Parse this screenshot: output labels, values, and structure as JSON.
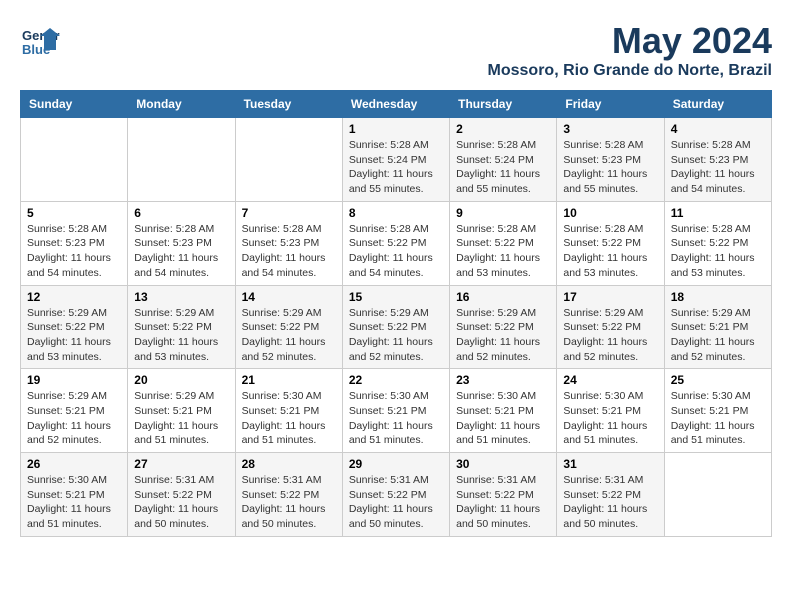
{
  "logo": {
    "line1": "General",
    "line2": "Blue"
  },
  "title": "May 2024",
  "location": "Mossoro, Rio Grande do Norte, Brazil",
  "days_header": [
    "Sunday",
    "Monday",
    "Tuesday",
    "Wednesday",
    "Thursday",
    "Friday",
    "Saturday"
  ],
  "weeks": [
    [
      {
        "day": "",
        "info": ""
      },
      {
        "day": "",
        "info": ""
      },
      {
        "day": "",
        "info": ""
      },
      {
        "day": "1",
        "info": "Sunrise: 5:28 AM\nSunset: 5:24 PM\nDaylight: 11 hours\nand 55 minutes."
      },
      {
        "day": "2",
        "info": "Sunrise: 5:28 AM\nSunset: 5:24 PM\nDaylight: 11 hours\nand 55 minutes."
      },
      {
        "day": "3",
        "info": "Sunrise: 5:28 AM\nSunset: 5:23 PM\nDaylight: 11 hours\nand 55 minutes."
      },
      {
        "day": "4",
        "info": "Sunrise: 5:28 AM\nSunset: 5:23 PM\nDaylight: 11 hours\nand 54 minutes."
      }
    ],
    [
      {
        "day": "5",
        "info": "Sunrise: 5:28 AM\nSunset: 5:23 PM\nDaylight: 11 hours\nand 54 minutes."
      },
      {
        "day": "6",
        "info": "Sunrise: 5:28 AM\nSunset: 5:23 PM\nDaylight: 11 hours\nand 54 minutes."
      },
      {
        "day": "7",
        "info": "Sunrise: 5:28 AM\nSunset: 5:23 PM\nDaylight: 11 hours\nand 54 minutes."
      },
      {
        "day": "8",
        "info": "Sunrise: 5:28 AM\nSunset: 5:22 PM\nDaylight: 11 hours\nand 54 minutes."
      },
      {
        "day": "9",
        "info": "Sunrise: 5:28 AM\nSunset: 5:22 PM\nDaylight: 11 hours\nand 53 minutes."
      },
      {
        "day": "10",
        "info": "Sunrise: 5:28 AM\nSunset: 5:22 PM\nDaylight: 11 hours\nand 53 minutes."
      },
      {
        "day": "11",
        "info": "Sunrise: 5:28 AM\nSunset: 5:22 PM\nDaylight: 11 hours\nand 53 minutes."
      }
    ],
    [
      {
        "day": "12",
        "info": "Sunrise: 5:29 AM\nSunset: 5:22 PM\nDaylight: 11 hours\nand 53 minutes."
      },
      {
        "day": "13",
        "info": "Sunrise: 5:29 AM\nSunset: 5:22 PM\nDaylight: 11 hours\nand 53 minutes."
      },
      {
        "day": "14",
        "info": "Sunrise: 5:29 AM\nSunset: 5:22 PM\nDaylight: 11 hours\nand 52 minutes."
      },
      {
        "day": "15",
        "info": "Sunrise: 5:29 AM\nSunset: 5:22 PM\nDaylight: 11 hours\nand 52 minutes."
      },
      {
        "day": "16",
        "info": "Sunrise: 5:29 AM\nSunset: 5:22 PM\nDaylight: 11 hours\nand 52 minutes."
      },
      {
        "day": "17",
        "info": "Sunrise: 5:29 AM\nSunset: 5:22 PM\nDaylight: 11 hours\nand 52 minutes."
      },
      {
        "day": "18",
        "info": "Sunrise: 5:29 AM\nSunset: 5:21 PM\nDaylight: 11 hours\nand 52 minutes."
      }
    ],
    [
      {
        "day": "19",
        "info": "Sunrise: 5:29 AM\nSunset: 5:21 PM\nDaylight: 11 hours\nand 52 minutes."
      },
      {
        "day": "20",
        "info": "Sunrise: 5:29 AM\nSunset: 5:21 PM\nDaylight: 11 hours\nand 51 minutes."
      },
      {
        "day": "21",
        "info": "Sunrise: 5:30 AM\nSunset: 5:21 PM\nDaylight: 11 hours\nand 51 minutes."
      },
      {
        "day": "22",
        "info": "Sunrise: 5:30 AM\nSunset: 5:21 PM\nDaylight: 11 hours\nand 51 minutes."
      },
      {
        "day": "23",
        "info": "Sunrise: 5:30 AM\nSunset: 5:21 PM\nDaylight: 11 hours\nand 51 minutes."
      },
      {
        "day": "24",
        "info": "Sunrise: 5:30 AM\nSunset: 5:21 PM\nDaylight: 11 hours\nand 51 minutes."
      },
      {
        "day": "25",
        "info": "Sunrise: 5:30 AM\nSunset: 5:21 PM\nDaylight: 11 hours\nand 51 minutes."
      }
    ],
    [
      {
        "day": "26",
        "info": "Sunrise: 5:30 AM\nSunset: 5:21 PM\nDaylight: 11 hours\nand 51 minutes."
      },
      {
        "day": "27",
        "info": "Sunrise: 5:31 AM\nSunset: 5:22 PM\nDaylight: 11 hours\nand 50 minutes."
      },
      {
        "day": "28",
        "info": "Sunrise: 5:31 AM\nSunset: 5:22 PM\nDaylight: 11 hours\nand 50 minutes."
      },
      {
        "day": "29",
        "info": "Sunrise: 5:31 AM\nSunset: 5:22 PM\nDaylight: 11 hours\nand 50 minutes."
      },
      {
        "day": "30",
        "info": "Sunrise: 5:31 AM\nSunset: 5:22 PM\nDaylight: 11 hours\nand 50 minutes."
      },
      {
        "day": "31",
        "info": "Sunrise: 5:31 AM\nSunset: 5:22 PM\nDaylight: 11 hours\nand 50 minutes."
      },
      {
        "day": "",
        "info": ""
      }
    ]
  ]
}
